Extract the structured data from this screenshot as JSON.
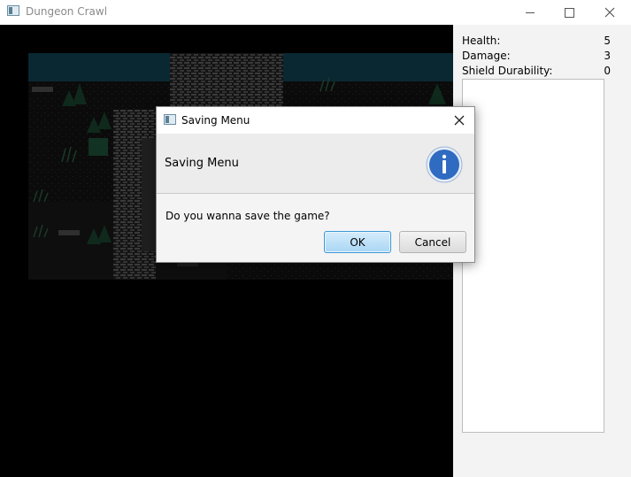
{
  "window": {
    "title": "Dungeon Crawl"
  },
  "stats": [
    {
      "label": "Health:",
      "value": "5"
    },
    {
      "label": "Damage:",
      "value": "3"
    },
    {
      "label": "Shield Durability:",
      "value": "0"
    }
  ],
  "dialog": {
    "title": "Saving Menu",
    "header": "Saving Menu",
    "content": "Do you wanna save the game?",
    "ok_label": "OK",
    "cancel_label": "Cancel",
    "icon": "info-icon"
  },
  "colors": {
    "game_background": "#000000",
    "ok_border": "#3c98d6",
    "info_blue": "#2f6bc1"
  }
}
